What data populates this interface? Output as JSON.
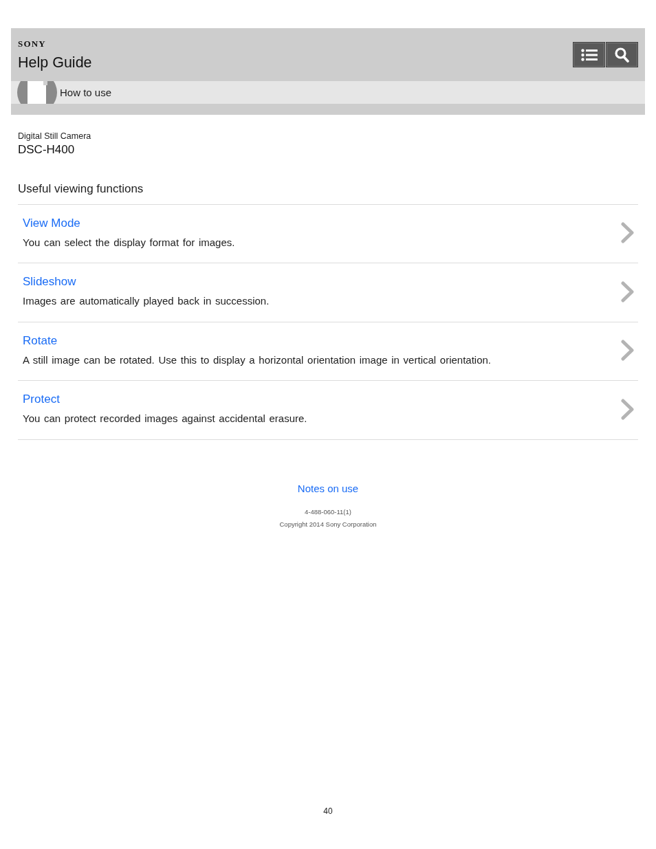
{
  "header": {
    "logo": "SONY",
    "title": "Help Guide"
  },
  "breadcrumb": {
    "label": "How to use"
  },
  "product": {
    "category": "Digital Still Camera",
    "model": "DSC-H400"
  },
  "section": {
    "title": "Useful viewing functions",
    "items": [
      {
        "title": "View Mode",
        "description": "You can select the display format for images."
      },
      {
        "title": "Slideshow",
        "description": "Images are automatically played back in succession."
      },
      {
        "title": "Rotate",
        "description": "A still image can be rotated. Use this to display a horizontal orientation image in vertical orientation."
      },
      {
        "title": "Protect",
        "description": "You can protect recorded images against accidental erasure."
      }
    ]
  },
  "footer": {
    "link": "Notes on use",
    "code": "4-488-060-11(1)",
    "copyright": "Copyright 2014 Sony Corporation"
  },
  "page_number": "40"
}
